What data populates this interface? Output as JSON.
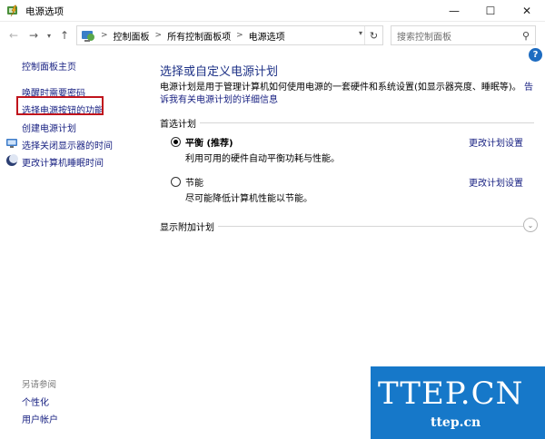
{
  "window": {
    "title": "电源选项",
    "minimize_glyph": "—",
    "maximize_glyph": "☐",
    "close_glyph": "✕"
  },
  "nav": {
    "back_glyph": "←",
    "forward_glyph": "→",
    "history_glyph": "▾",
    "up_glyph": "↑",
    "breadcrumb": [
      "控制面板",
      "所有控制面板项",
      "电源选项"
    ],
    "breadcrumb_separator": ">",
    "dropdown_glyph": "▾",
    "refresh_glyph": "↻",
    "search_placeholder": "搜索控制面板",
    "search_glyph": "⚲"
  },
  "help_glyph": "?",
  "sidebar": {
    "home": "控制面板主页",
    "items": [
      {
        "label": "唤醒时需要密码",
        "icon": null
      },
      {
        "label": "选择电源按钮的功能",
        "icon": null
      },
      {
        "label": "创建电源计划",
        "icon": null
      },
      {
        "label": "选择关闭显示器的时间",
        "icon": "monitor-icon"
      },
      {
        "label": "更改计算机睡眠时间",
        "icon": "moon-icon"
      }
    ],
    "see_also_heading": "另请参阅",
    "see_also": [
      "个性化",
      "用户帐户"
    ]
  },
  "main": {
    "title": "选择或自定义电源计划",
    "description": "电源计划是用于管理计算机如何使用电源的一套硬件和系统设置(如显示器亮度、睡眠等)。",
    "description_link": "告诉我有关电源计划的详细信息",
    "preferred_heading": "首选计划",
    "plans": [
      {
        "name": "平衡 (推荐)",
        "description": "利用可用的硬件自动平衡功耗与性能。",
        "link": "更改计划设置",
        "selected": true
      },
      {
        "name": "节能",
        "description": "尽可能降低计算机性能以节能。",
        "link": "更改计划设置",
        "selected": false
      }
    ],
    "more_plans_heading": "显示附加计划",
    "expand_glyph": "⌄"
  },
  "watermark": {
    "big": "TTEP.CN",
    "small": "ttep.cn"
  },
  "colors": {
    "link": "#151e80",
    "title": "#1e3287",
    "highlight": "#c0141c",
    "watermark_bg": "#1678c9"
  }
}
